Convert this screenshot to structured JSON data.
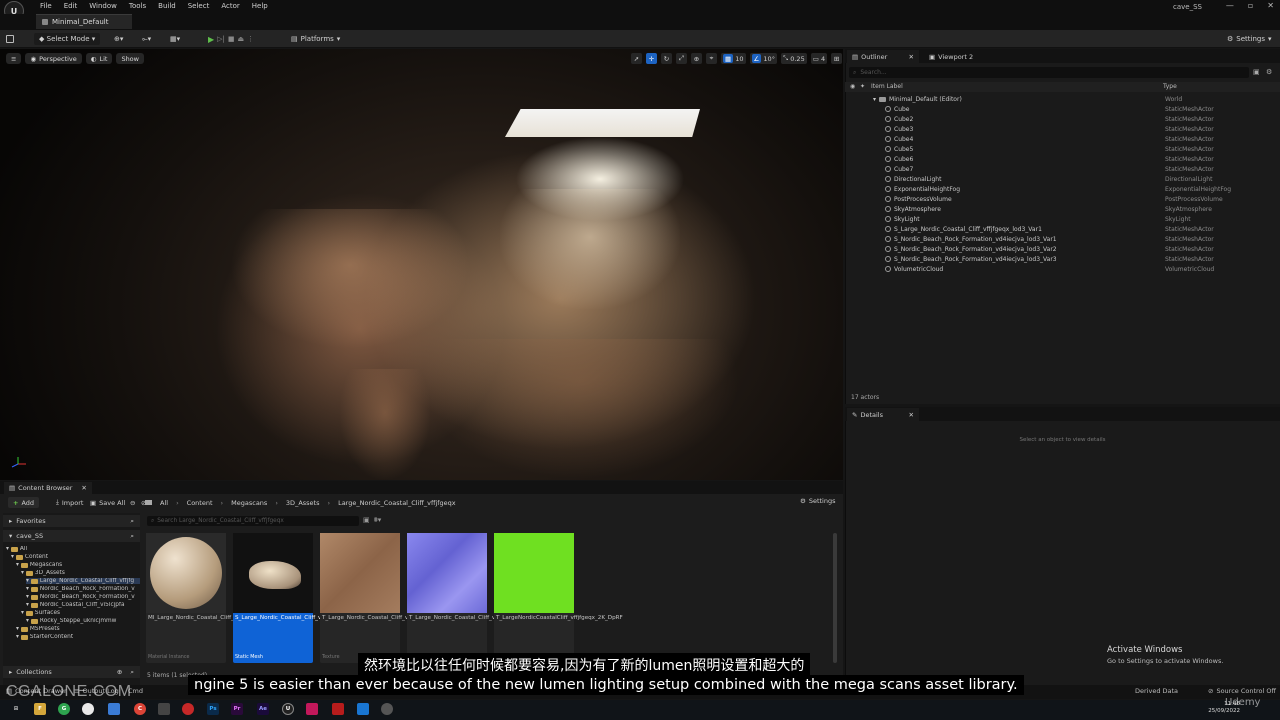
{
  "menubar": {
    "logo": "U",
    "menus": [
      "File",
      "Edit",
      "Window",
      "Tools",
      "Build",
      "Select",
      "Actor",
      "Help"
    ],
    "project": "cave_SS",
    "window_controls": [
      "—",
      "▫",
      "✕"
    ]
  },
  "level_tab": {
    "label": "Minimal_Default"
  },
  "toolbar": {
    "select_mode": "Select Mode",
    "platforms": "Platforms",
    "settings": "Settings"
  },
  "viewport": {
    "perspective": "Perspective",
    "lit": "Lit",
    "show": "Show",
    "grid_snap": "10",
    "rot_snap": "10°",
    "scale_snap": "0.25",
    "camera_speed": "4"
  },
  "outliner": {
    "tab_outliner": "Outliner",
    "tab_viewport2": "Viewport 2",
    "search_placeholder": "Search...",
    "col_label": "Item Label",
    "col_type": "Type",
    "root": {
      "label": "Minimal_Default (Editor)",
      "type": "World"
    },
    "rows": [
      {
        "label": "Cube",
        "type": "StaticMeshActor"
      },
      {
        "label": "Cube2",
        "type": "StaticMeshActor"
      },
      {
        "label": "Cube3",
        "type": "StaticMeshActor"
      },
      {
        "label": "Cube4",
        "type": "StaticMeshActor"
      },
      {
        "label": "Cube5",
        "type": "StaticMeshActor"
      },
      {
        "label": "Cube6",
        "type": "StaticMeshActor"
      },
      {
        "label": "Cube7",
        "type": "StaticMeshActor"
      },
      {
        "label": "DirectionalLight",
        "type": "DirectionalLight"
      },
      {
        "label": "ExponentialHeightFog",
        "type": "ExponentialHeightFog"
      },
      {
        "label": "PostProcessVolume",
        "type": "PostProcessVolume"
      },
      {
        "label": "SkyAtmosphere",
        "type": "SkyAtmosphere"
      },
      {
        "label": "SkyLight",
        "type": "SkyLight"
      },
      {
        "label": "S_Large_Nordic_Coastal_Cliff_vffjfgeqx_lod3_Var1",
        "type": "StaticMeshActor"
      },
      {
        "label": "S_Nordic_Beach_Rock_Formation_vd4iecjva_lod3_Var1",
        "type": "StaticMeshActor"
      },
      {
        "label": "S_Nordic_Beach_Rock_Formation_vd4iecjva_lod3_Var2",
        "type": "StaticMeshActor"
      },
      {
        "label": "S_Nordic_Beach_Rock_Formation_vd4iecjva_lod3_Var3",
        "type": "StaticMeshActor"
      },
      {
        "label": "VolumetricCloud",
        "type": "VolumetricCloud"
      }
    ],
    "actor_count": "17 actors"
  },
  "details": {
    "tab": "Details",
    "empty": "Select an object to view details"
  },
  "content_browser": {
    "tab": "Content Browser",
    "add": "Add",
    "import": "Import",
    "save_all": "Save All",
    "breadcrumb": [
      "All",
      "Content",
      "Megascans",
      "3D_Assets",
      "Large_Nordic_Coastal_Cliff_vffjfgeqx"
    ],
    "settings": "Settings",
    "favorites": "Favorites",
    "project": "cave_SS",
    "tree": [
      {
        "label": "All",
        "indent": 0
      },
      {
        "label": "Content",
        "indent": 1
      },
      {
        "label": "Megascans",
        "indent": 2
      },
      {
        "label": "3D_Assets",
        "indent": 3
      },
      {
        "label": "Large_Nordic_Coastal_Cliff_vffjfg",
        "indent": 4,
        "selected": true
      },
      {
        "label": "Nordic_Beach_Rock_Formation_v",
        "indent": 4
      },
      {
        "label": "Nordic_Beach_Rock_Formation_v",
        "indent": 4
      },
      {
        "label": "Nordic_Coastal_Cliff_vi5lcjpfa",
        "indent": 4
      },
      {
        "label": "Surfaces",
        "indent": 3
      },
      {
        "label": "Rocky_Steppe_uknicjmmw",
        "indent": 4
      },
      {
        "label": "MSPresets",
        "indent": 2
      },
      {
        "label": "StarterContent",
        "indent": 2
      }
    ],
    "collections": "Collections",
    "search_placeholder": "Search Large_Nordic_Coastal_Cliff_vffjfgeqx",
    "assets": [
      {
        "name": "MI_Large_Nordic_Coastal_Cliff_vffjfgeqx_2K",
        "class": "Material Instance",
        "color": "#c9b59a",
        "selected": false
      },
      {
        "name": "S_Large_Nordic_Coastal_Cliff_vffjfgeqx_lod3_Var1",
        "class": "Static Mesh",
        "color": "#d6c5ad",
        "selected": true
      },
      {
        "name": "T_Large_Nordic_Coastal_Cliff_vffjfgeqx_2K_D",
        "class": "Texture",
        "color": "#a07a5c",
        "selected": false
      },
      {
        "name": "T_Large_Nordic_Coastal_Cliff_vffjfgeqx_2K_N",
        "class": "Texture",
        "color": "#7d7be0",
        "selected": false
      },
      {
        "name": "T_LargeNordicCoastalCliff_vffjfgeqx_2K_DpRF",
        "class": "Texture",
        "color": "#6fe021",
        "selected": false
      }
    ],
    "status": "5 items (1 selected)"
  },
  "statusbar": {
    "content_drawer": "Content Drawer",
    "output_log": "Output Log",
    "cmd": "Cmd",
    "derived_data": "Derived Data",
    "source_control": "Source Control Off"
  },
  "taskbar": {
    "time": "11:46",
    "date": "25/09/2022",
    "apps": [
      "F",
      "G",
      "",
      "",
      "C",
      "",
      "Ps",
      "Pr",
      "Ae",
      "U",
      "",
      "",
      "",
      ""
    ]
  },
  "overlay": {
    "activate_title": "Activate Windows",
    "activate_sub": "Go to Settings to activate Windows.",
    "subtitle_cn": "然环境比以往任何时候都要容易,因为有了新的lumen照明设置和超大的",
    "subtitle_en": "ngine 5 is easier than ever because of the new lumen lighting setup combined with the mega scans asset library.",
    "watermark": "CGALONE.COM",
    "udemy": "Udemy"
  }
}
